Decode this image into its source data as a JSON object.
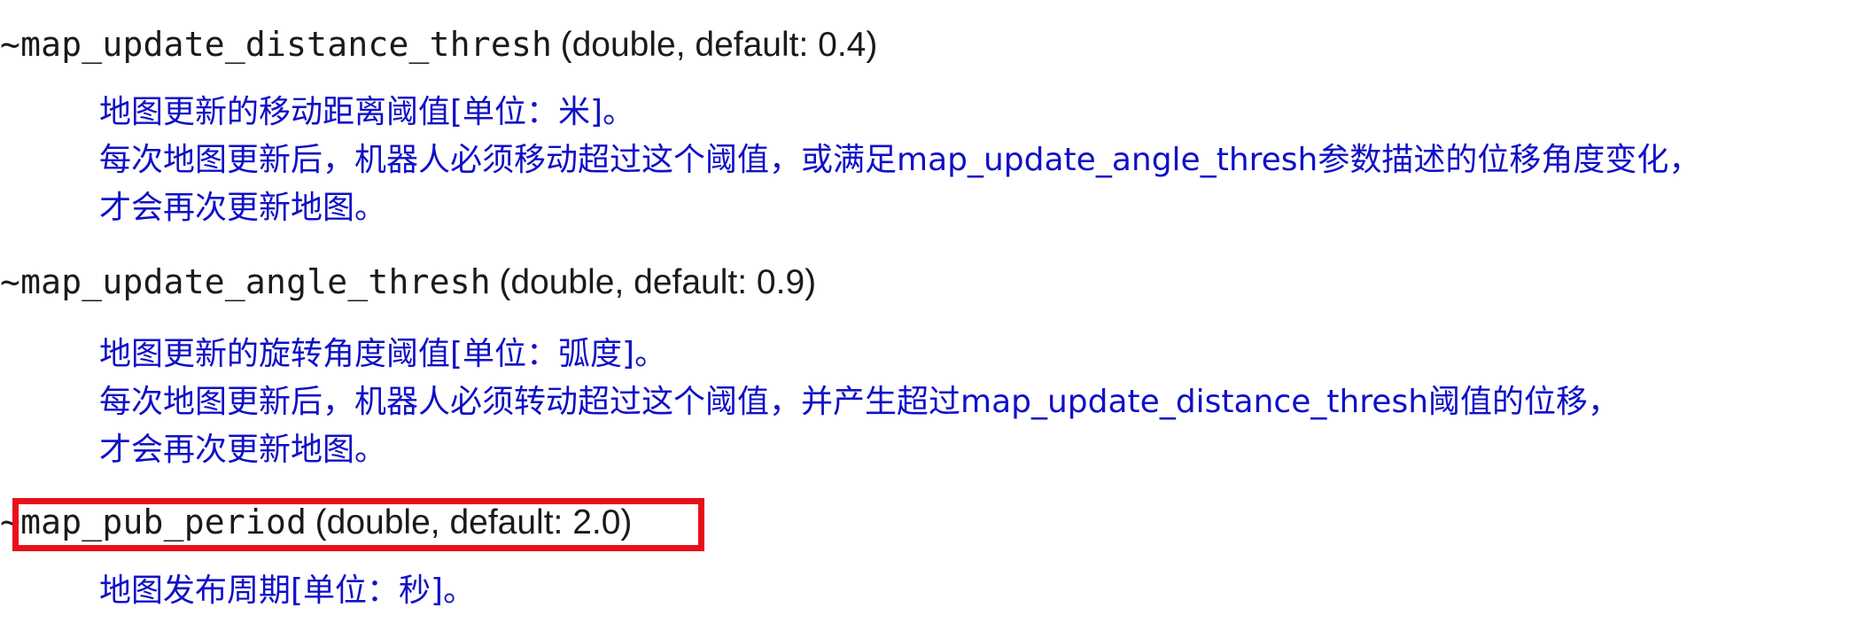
{
  "params": [
    {
      "name": "~map_update_distance_thresh",
      "meta": "(double, default: 0.4)",
      "lines": [
        "地图更新的移动距离阈值[单位：米]。",
        "每次地图更新后，机器人必须移动超过这个阈值，或满足map_update_angle_thresh参数描述的位移角度变化，",
        "才会再次更新地图。"
      ]
    },
    {
      "name": "~map_update_angle_thresh",
      "meta": "(double, default: 0.9)",
      "lines": [
        "地图更新的旋转角度阈值[单位：弧度]。",
        "每次地图更新后，机器人必须转动超过这个阈值，并产生超过map_update_distance_thresh阈值的位移，",
        "才会再次更新地图。"
      ]
    },
    {
      "name": "~map_pub_period",
      "meta": "(double, default: 2.0)",
      "lines": [
        "地图发布周期[单位：秒]。"
      ]
    }
  ],
  "colors": {
    "description_text": "#1010c8",
    "highlight_border": "#e8101a",
    "param_text": "#1a1a1a"
  }
}
